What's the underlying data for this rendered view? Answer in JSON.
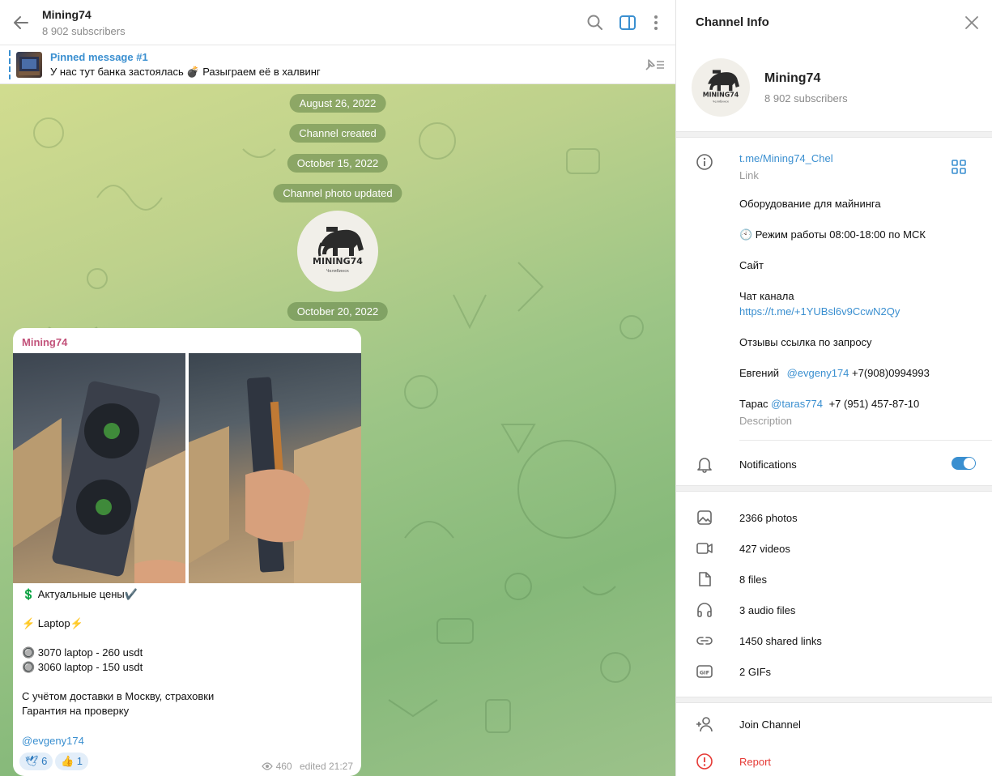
{
  "header": {
    "title": "Mining74",
    "subtitle": "8 902 subscribers"
  },
  "pinned": {
    "title": "Pinned message #1",
    "text": "У нас тут банка застоялась 💣 Разыграем её в халвинг"
  },
  "chat": {
    "service": [
      "August 26, 2022",
      "Channel created",
      "October 15, 2022",
      "Channel photo updated",
      "October 20, 2022"
    ],
    "logo_text": "MINING74",
    "logo_sub": "Челябинск",
    "message": {
      "author": "Mining74",
      "line1": "💲 Актуальные цены✔️",
      "line2": "⚡ Laptop⚡",
      "line3": "🔘 3070 laptop - 260 usdt",
      "line4": "🔘 3060 laptop - 150 usdt",
      "line5": "С учётом доставки в Москву, страховки",
      "line6": "Гарантия на проверку",
      "mention": "@evgeny174",
      "reaction1": "🕊 6",
      "reaction2": "👍 1",
      "views": "460",
      "edited": "edited 21:27"
    }
  },
  "info": {
    "title": "Channel Info",
    "name": "Mining74",
    "subs": "8 902 subscribers",
    "link": "t.me/Mining74_Chel",
    "link_label": "Link",
    "desc": {
      "l1": "Оборудование для майнинга",
      "l2": "🕙 Режим работы 08:00-18:00 по МСК",
      "l3": "Сайт",
      "l4": "Чат канала",
      "l5": "https://t.me/+1YUBsl6v9CcwN2Qy",
      "l6": "Отзывы ссылка по запросу",
      "l7a": "Евгений",
      "l7b": "@evgeny174",
      "l7c": "+7(908)0994993",
      "l8a": "Тарас",
      "l8b": "@taras774",
      "l8c": "+7 (951) 457-87-10",
      "label": "Description"
    },
    "notifications": "Notifications",
    "notifications_on": true,
    "media": {
      "photos": "2366 photos",
      "videos": "427 videos",
      "files": "8 files",
      "audio": "3 audio files",
      "links": "1450 shared links",
      "gifs": "2 GIFs"
    },
    "join": "Join Channel",
    "report": "Report"
  },
  "colors": {
    "accent": "#3a8fd0",
    "author": "#c2527a",
    "report": "#e53935"
  }
}
